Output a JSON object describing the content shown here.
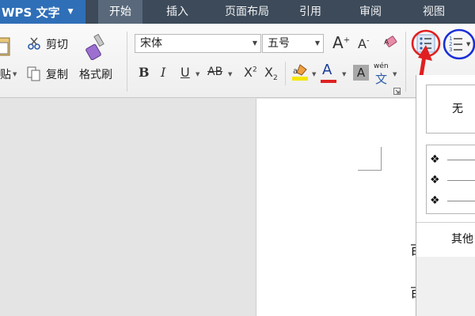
{
  "app": {
    "title": "WPS 文字"
  },
  "tabs": [
    {
      "label": "开始",
      "active": true
    },
    {
      "label": "插入"
    },
    {
      "label": "页面布局"
    },
    {
      "label": "引用"
    },
    {
      "label": "审阅"
    },
    {
      "label": "视图"
    }
  ],
  "clipboard": {
    "paste_label": "粘贴",
    "paste_visible": "贴",
    "cut_label": "剪切",
    "copy_label": "复制",
    "format_painter_label": "格式刷"
  },
  "font": {
    "family_value": "宋体",
    "size_value": "五号",
    "grow_label": "A",
    "shrink_label": "A",
    "bold": "B",
    "italic": "I",
    "underline": "U",
    "strikethrough": "AB",
    "superscript": "X",
    "subscript": "X",
    "font_color": "A",
    "char_shading": "A",
    "phonetic_top": "wén",
    "phonetic_bottom": "文"
  },
  "bullet_menu": {
    "none_label": "无",
    "bullet_symbol": "❖",
    "more_label": "其他"
  },
  "document": {
    "peek_text_1": "百",
    "peek_text_2": "百度"
  },
  "colors": {
    "tab_bar": "#3c4a5a",
    "app_button": "#2f6fb8",
    "highlight_red": "#e02020",
    "highlight_blue": "#1a2fd8",
    "font_color_red": "#e02020",
    "highlighter_yellow": "#f5e600"
  }
}
